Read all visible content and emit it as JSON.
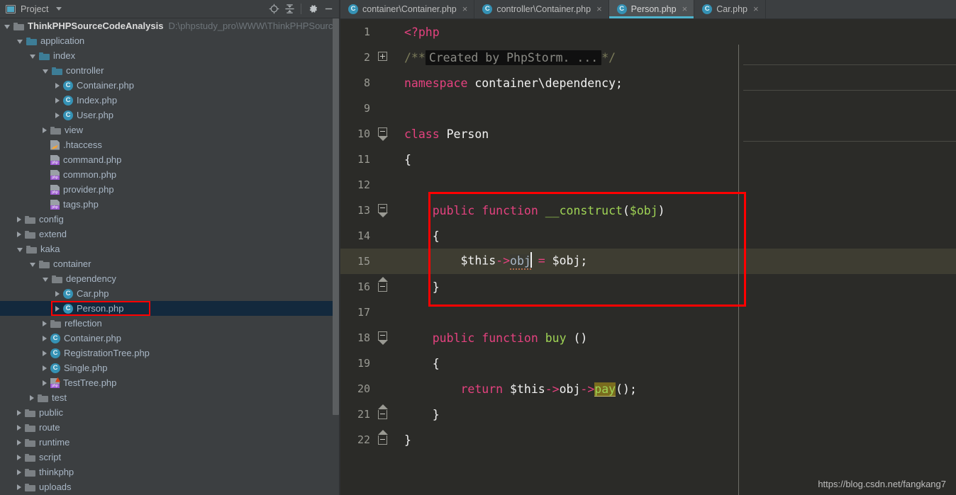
{
  "sidebar": {
    "tool_title": "Project",
    "toolbar_icons": [
      "locate-icon",
      "collapse-all-icon",
      "settings-gear-icon",
      "minimize-icon"
    ],
    "scrollbar": "vertical-scrollbar",
    "tree": [
      {
        "indent": 0,
        "arrow": "open",
        "icon": "folder",
        "label": "ThinkPHPSourceCodeAnalysis",
        "path": "D:\\phpstudy_pro\\WWW\\ThinkPHPSourceCo",
        "root": true
      },
      {
        "indent": 1,
        "arrow": "open",
        "icon": "folder-teal",
        "label": "application"
      },
      {
        "indent": 2,
        "arrow": "open",
        "icon": "folder-teal",
        "label": "index"
      },
      {
        "indent": 3,
        "arrow": "open",
        "icon": "folder-teal",
        "label": "controller"
      },
      {
        "indent": 4,
        "arrow": "closed",
        "icon": "class",
        "label": "Container.php"
      },
      {
        "indent": 4,
        "arrow": "closed",
        "icon": "class",
        "label": "Index.php"
      },
      {
        "indent": 4,
        "arrow": "closed",
        "icon": "class",
        "label": "User.php"
      },
      {
        "indent": 3,
        "arrow": "closed",
        "icon": "folder",
        "label": "view"
      },
      {
        "indent": 3,
        "arrow": "none",
        "icon": "htaccess",
        "label": ".htaccess"
      },
      {
        "indent": 3,
        "arrow": "none",
        "icon": "php",
        "label": "command.php"
      },
      {
        "indent": 3,
        "arrow": "none",
        "icon": "php",
        "label": "common.php"
      },
      {
        "indent": 3,
        "arrow": "none",
        "icon": "php",
        "label": "provider.php"
      },
      {
        "indent": 3,
        "arrow": "none",
        "icon": "php",
        "label": "tags.php"
      },
      {
        "indent": 1,
        "arrow": "closed",
        "icon": "folder",
        "label": "config"
      },
      {
        "indent": 1,
        "arrow": "closed",
        "icon": "folder",
        "label": "extend"
      },
      {
        "indent": 1,
        "arrow": "open",
        "icon": "folder",
        "label": "kaka"
      },
      {
        "indent": 2,
        "arrow": "open",
        "icon": "folder",
        "label": "container"
      },
      {
        "indent": 3,
        "arrow": "open",
        "icon": "folder",
        "label": "dependency"
      },
      {
        "indent": 4,
        "arrow": "closed",
        "icon": "class",
        "label": "Car.php"
      },
      {
        "indent": 4,
        "arrow": "closed",
        "icon": "class",
        "label": "Person.php",
        "selected": true,
        "boxed": true
      },
      {
        "indent": 3,
        "arrow": "closed",
        "icon": "folder",
        "label": "reflection"
      },
      {
        "indent": 3,
        "arrow": "closed",
        "icon": "class",
        "label": "Container.php"
      },
      {
        "indent": 3,
        "arrow": "closed",
        "icon": "class",
        "label": "RegistrationTree.php"
      },
      {
        "indent": 3,
        "arrow": "closed",
        "icon": "class",
        "label": "Single.php"
      },
      {
        "indent": 3,
        "arrow": "closed",
        "icon": "php-red",
        "label": "TestTree.php"
      },
      {
        "indent": 2,
        "arrow": "closed",
        "icon": "folder",
        "label": "test"
      },
      {
        "indent": 1,
        "arrow": "closed",
        "icon": "folder",
        "label": "public"
      },
      {
        "indent": 1,
        "arrow": "closed",
        "icon": "folder",
        "label": "route"
      },
      {
        "indent": 1,
        "arrow": "closed",
        "icon": "folder",
        "label": "runtime"
      },
      {
        "indent": 1,
        "arrow": "closed",
        "icon": "folder",
        "label": "script"
      },
      {
        "indent": 1,
        "arrow": "closed",
        "icon": "folder",
        "label": "thinkphp"
      },
      {
        "indent": 1,
        "arrow": "closed",
        "icon": "folder",
        "label": "uploads"
      }
    ]
  },
  "editor": {
    "tabs": [
      {
        "label": "container\\Container.php",
        "active": false
      },
      {
        "label": "controller\\Container.php",
        "active": false
      },
      {
        "label": "Person.php",
        "active": true
      },
      {
        "label": "Car.php",
        "active": false
      }
    ],
    "close_glyph": "×",
    "accent_color": "#4EB3CC",
    "current_line": 15,
    "lines": [
      {
        "num": "1",
        "fold": "none",
        "text": "<?php"
      },
      {
        "num": "2",
        "fold": "plus",
        "text": "/** Created by PhpStorm. ...*/",
        "folded_label": "Created by PhpStorm. ..."
      },
      {
        "num": "8",
        "fold": "none",
        "text": "namespace container\\dependency;"
      },
      {
        "num": "9",
        "fold": "none",
        "text": ""
      },
      {
        "num": "10",
        "fold": "arrow-dn",
        "text": "class Person"
      },
      {
        "num": "11",
        "fold": "none",
        "text": "{"
      },
      {
        "num": "12",
        "fold": "none",
        "text": ""
      },
      {
        "num": "13",
        "fold": "arrow-dn",
        "text": "    public function __construct($obj)"
      },
      {
        "num": "14",
        "fold": "none",
        "text": "    {"
      },
      {
        "num": "15",
        "fold": "none",
        "text": "        $this->obj = $obj;",
        "current": true
      },
      {
        "num": "16",
        "fold": "arrow-up",
        "text": "    }"
      },
      {
        "num": "17",
        "fold": "none",
        "text": ""
      },
      {
        "num": "18",
        "fold": "arrow-dn",
        "text": "    public function buy ()"
      },
      {
        "num": "19",
        "fold": "none",
        "text": "    {"
      },
      {
        "num": "20",
        "fold": "none",
        "text": "        return $this->obj->pay();"
      },
      {
        "num": "21",
        "fold": "arrow-up",
        "text": "    }"
      },
      {
        "num": "22",
        "fold": "arrow-up",
        "text": "}"
      }
    ],
    "annotations": {
      "red_box_code": "highlights constructor lines 13-16",
      "red_box_tree": "highlights Person.php tree node",
      "usage_highlight_token": "pay",
      "error_token": "obj"
    }
  },
  "watermark": "https://blog.csdn.net/fangkang7"
}
